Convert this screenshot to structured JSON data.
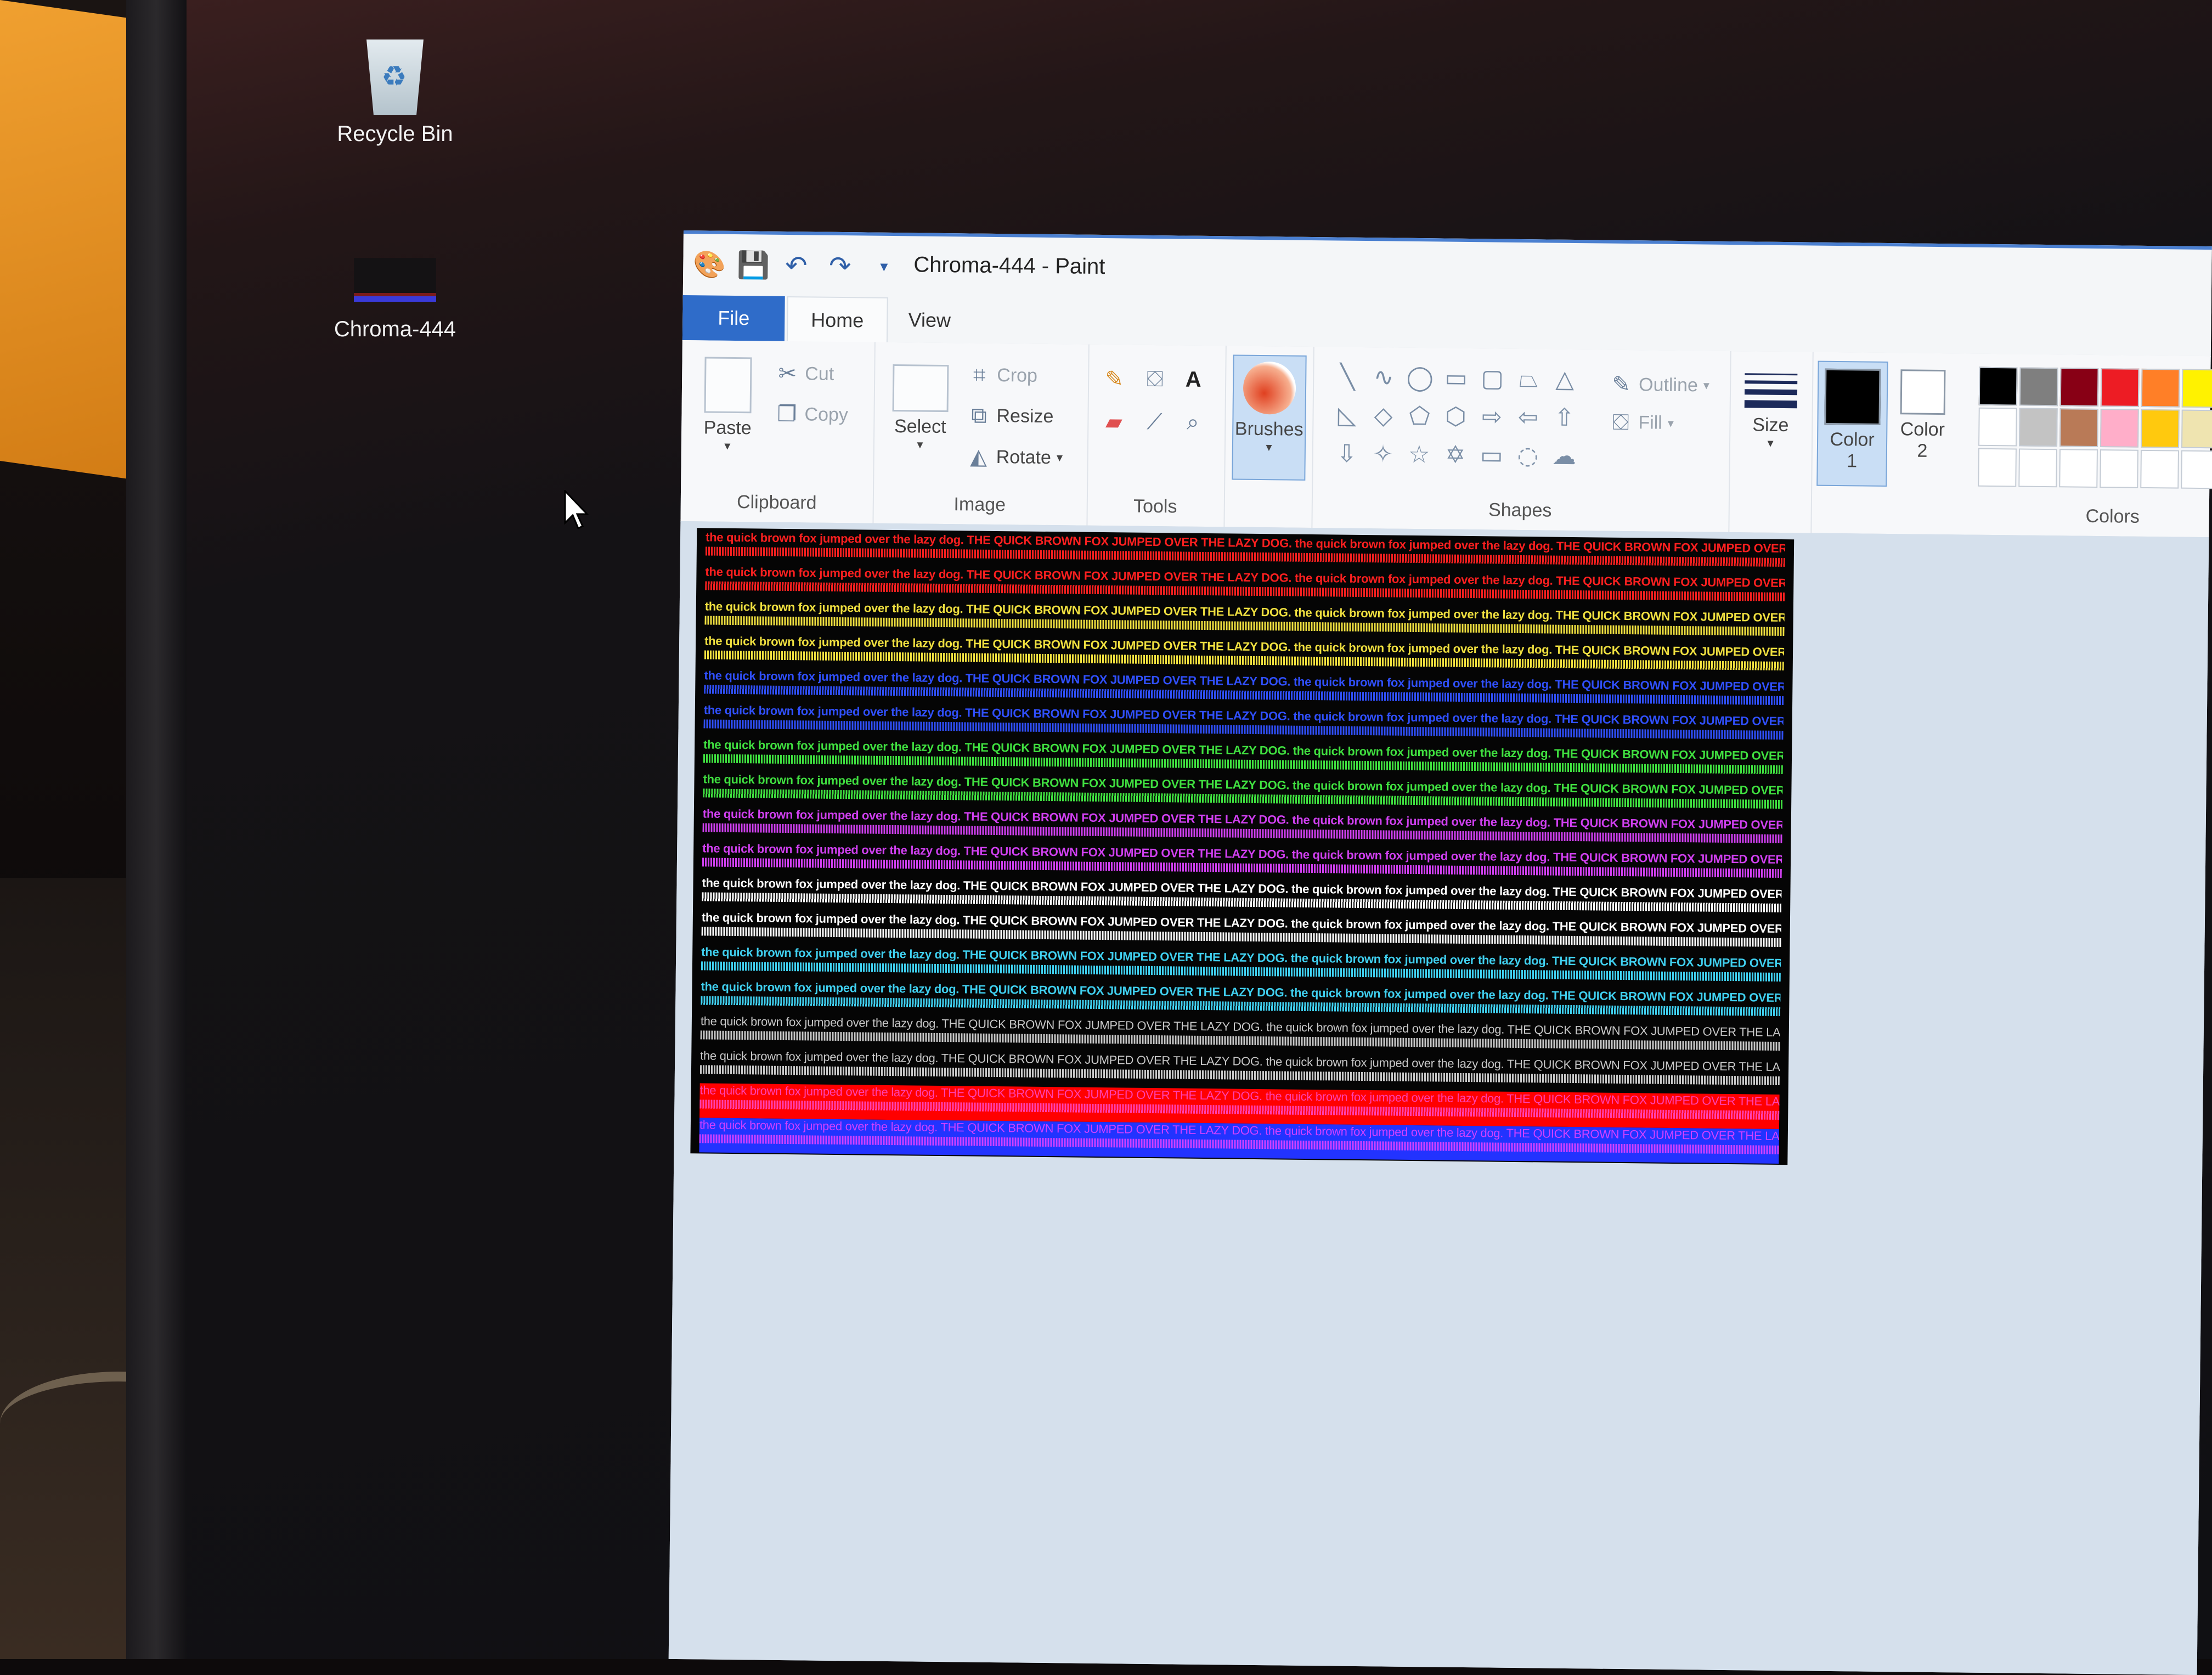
{
  "desktop": {
    "icons": [
      {
        "label": "Recycle Bin"
      },
      {
        "label": "Chroma-444"
      }
    ]
  },
  "window": {
    "title": "Chroma-444 - Paint",
    "tabs": {
      "file": "File",
      "home": "Home",
      "view": "View"
    },
    "ribbon": {
      "clipboard": {
        "label": "Clipboard",
        "paste": "Paste",
        "cut": "Cut",
        "copy": "Copy"
      },
      "image": {
        "label": "Image",
        "select": "Select",
        "crop": "Crop",
        "resize": "Resize",
        "rotate": "Rotate"
      },
      "tools": {
        "label": "Tools"
      },
      "brushes": {
        "label": "Brushes"
      },
      "shapes": {
        "label": "Shapes",
        "outline": "Outline",
        "fill": "Fill"
      },
      "size": {
        "label": "Size"
      },
      "color1": {
        "label": "Color",
        "num": "1"
      },
      "color2": {
        "label": "Color",
        "num": "2"
      },
      "colors": {
        "label": "Colors"
      },
      "palette": [
        "#000000",
        "#7f7f7f",
        "#880015",
        "#ed1c24",
        "#ff7f27",
        "#fff200",
        "#ffffff",
        "#c3c3c3",
        "#b97a57",
        "#ffaec9",
        "#ffc90e",
        "#efe4b0",
        "#ffffff",
        "#ffffff",
        "#ffffff",
        "#ffffff",
        "#ffffff",
        "#ffffff"
      ]
    },
    "canvas": {
      "text": "the quick brown fox jumped over the lazy dog. THE QUICK BROWN FOX JUMPED OVER THE LAZY DOG. the quick brown fox jumped over the lazy dog. THE QUICK BROWN FOX JUMPED OVER THE LAZY DOG.",
      "lines": [
        {
          "color": "#ff2020",
          "bg": "",
          "weight": "bold"
        },
        {
          "color": "#ff2020",
          "bg": "",
          "weight": "bold"
        },
        {
          "color": "#f0e040",
          "bg": "",
          "weight": "bold"
        },
        {
          "color": "#f0e040",
          "bg": "",
          "weight": "bold"
        },
        {
          "color": "#3050ff",
          "bg": "",
          "weight": "bold"
        },
        {
          "color": "#3050ff",
          "bg": "",
          "weight": "bold"
        },
        {
          "color": "#40e040",
          "bg": "",
          "weight": "bold"
        },
        {
          "color": "#40e040",
          "bg": "",
          "weight": "bold"
        },
        {
          "color": "#d040f0",
          "bg": "",
          "weight": "bold"
        },
        {
          "color": "#d040f0",
          "bg": "",
          "weight": "bold"
        },
        {
          "color": "#ffffff",
          "bg": "",
          "weight": "bold"
        },
        {
          "color": "#ffffff",
          "bg": "",
          "weight": "bold"
        },
        {
          "color": "#40d0f0",
          "bg": "",
          "weight": "bold"
        },
        {
          "color": "#40d0f0",
          "bg": "",
          "weight": "bold"
        },
        {
          "color": "#c8c8c8",
          "bg": "",
          "weight": "normal"
        },
        {
          "color": "#c8c8c8",
          "bg": "",
          "weight": "normal"
        },
        {
          "color": "#ff40b0",
          "bg": "#ff0000",
          "weight": "normal"
        },
        {
          "color": "#d040ff",
          "bg": "#2233ff",
          "weight": "normal"
        }
      ]
    }
  }
}
